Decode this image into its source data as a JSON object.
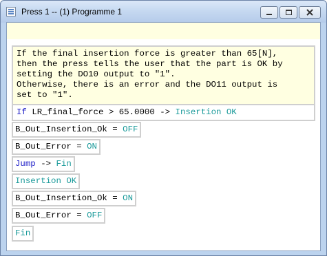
{
  "window": {
    "title": "Press 1 -- (1) Programme 1",
    "buttons": {
      "minimize": "minimize",
      "maximize": "maximize",
      "close": "close"
    }
  },
  "condition_block": {
    "comment": "If the final insertion force is greater than 65[N],\nthen the press tells the user that the part is OK by\nsetting the DO10 output to \"1\".\nOtherwise, there is an error and the DO11 output is\nset to \"1\".",
    "keyword": "If",
    "expression": "LR_final_force > 65.0000 ->",
    "target": "Insertion OK"
  },
  "steps": [
    {
      "var": "B_Out_Insertion_Ok =",
      "value": "OFF"
    },
    {
      "var": "B_Out_Error =",
      "value": "ON"
    },
    {
      "keyword": "Jump",
      "arrow": "->",
      "target": "Fin"
    },
    {
      "label": "Insertion OK"
    },
    {
      "var": "B_Out_Insertion_Ok =",
      "value": "ON"
    },
    {
      "var": "B_Out_Error =",
      "value": "OFF"
    },
    {
      "label": "Fin"
    }
  ],
  "colors": {
    "keyword": "#2222c8",
    "value": "#1a9a9a",
    "comment_background": "#ffffe1",
    "block_border": "#cfcfcf"
  }
}
